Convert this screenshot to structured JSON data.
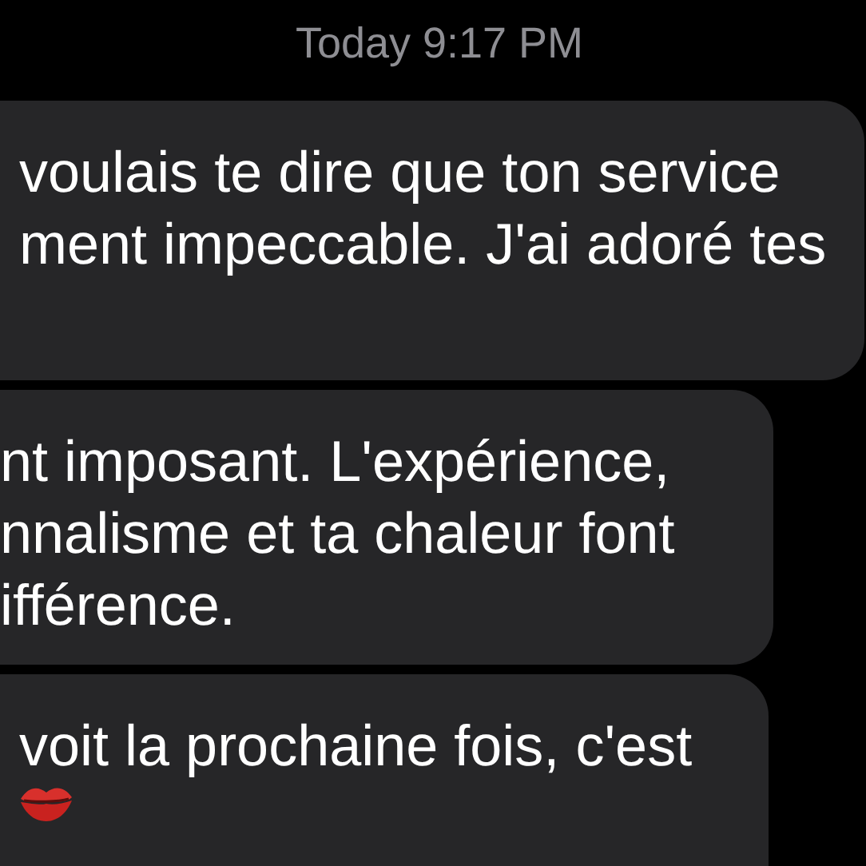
{
  "timestamp": "Today 9:17 PM",
  "messages": [
    {
      "lines": [
        "voulais te dire que ton service",
        "ment impeccable. J'ai adoré tes"
      ]
    },
    {
      "lines": [
        "nt imposant. L'expérience,",
        "nnalisme et ta chaleur font",
        "ifférence."
      ]
    },
    {
      "lines": [
        "voit la prochaine fois, c'est"
      ],
      "lips_emoji": true
    }
  ]
}
